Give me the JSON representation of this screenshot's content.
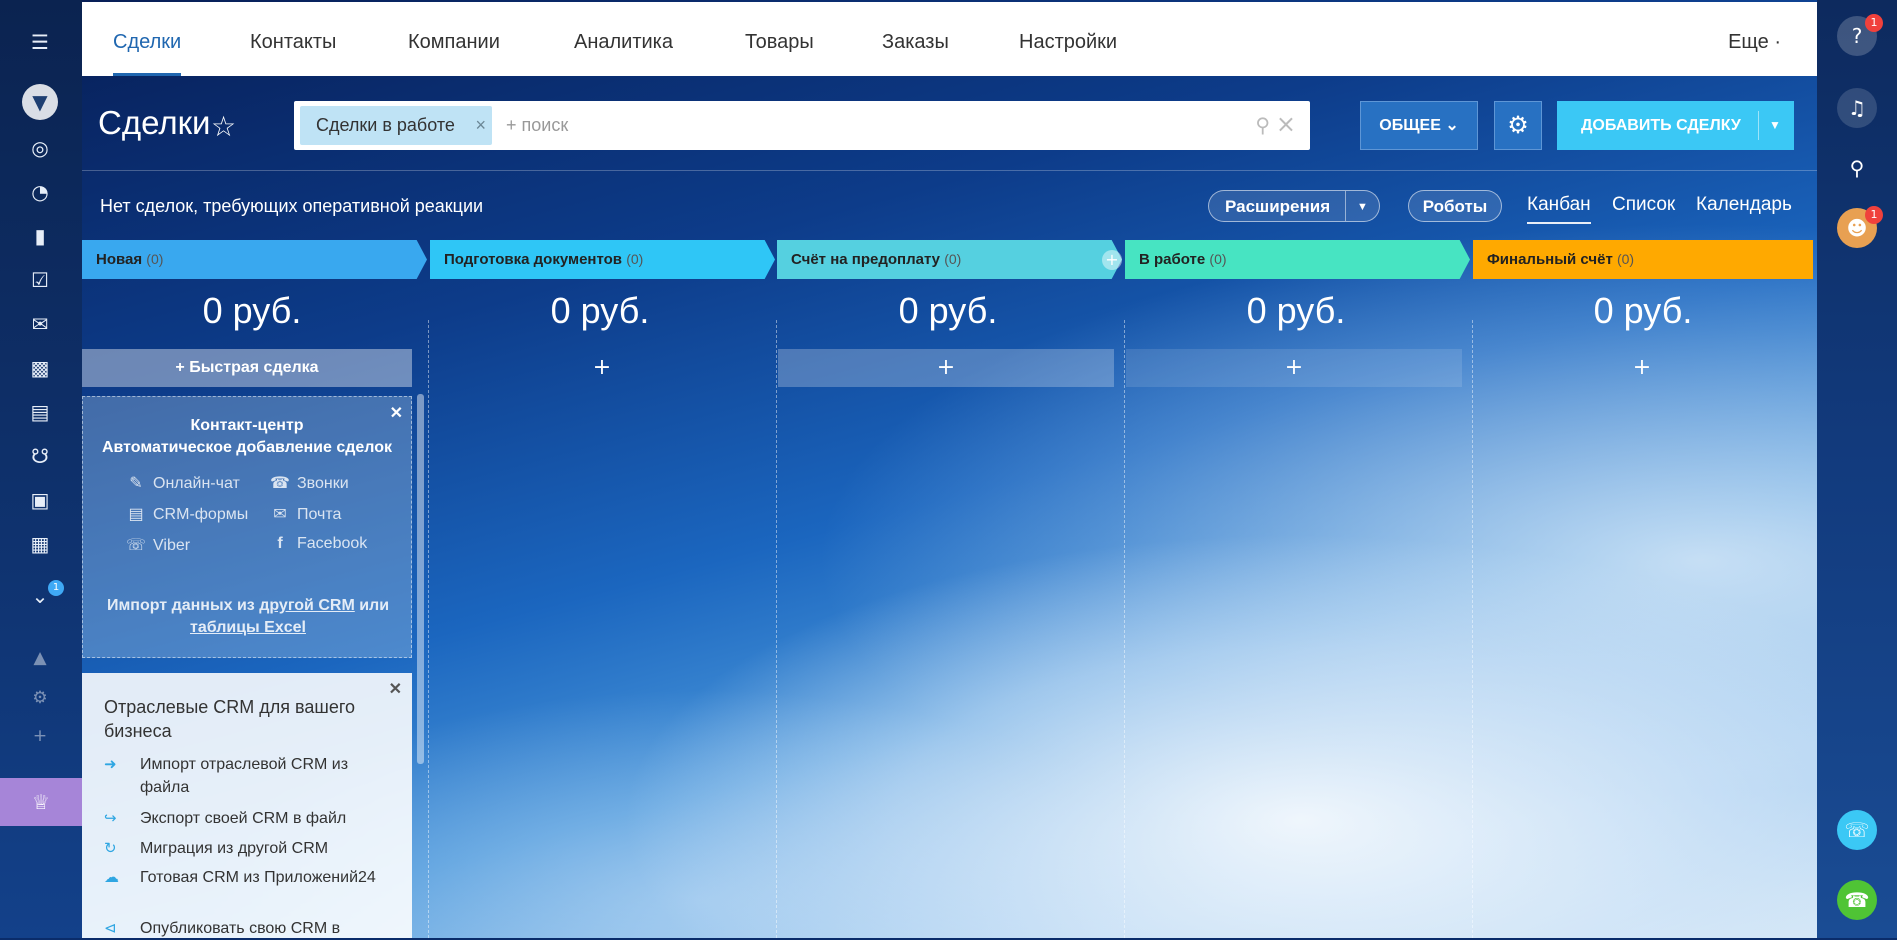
{
  "nav": {
    "tabs": [
      "Сделки",
      "Контакты",
      "Компании",
      "Аналитика",
      "Товары",
      "Заказы",
      "Настройки"
    ],
    "more": "Еще ·"
  },
  "sidebar": {
    "badge": "1"
  },
  "rightbar": {
    "help_badge": "1",
    "avatar_badge": "1"
  },
  "header": {
    "title": "Сделки",
    "filter_chip": "Сделки в работе",
    "chip_close": "×",
    "search_placeholder": "+ поиск",
    "general_button": "ОБЩЕЕ",
    "add_button": "ДОБАВИТЬ СДЕЛКУ"
  },
  "toolbar": {
    "notice": "Нет сделок, требующих оперативной реакции",
    "extensions": "Расширения",
    "robots": "Роботы",
    "views": [
      "Канбан",
      "Список",
      "Календарь"
    ]
  },
  "kanban": {
    "stages": [
      {
        "name": "Новая",
        "count": "(0)",
        "sum": "0 руб.",
        "color": "#39a8ef"
      },
      {
        "name": "Подготовка документов",
        "count": "(0)",
        "sum": "0 руб.",
        "color": "#2fc6f6"
      },
      {
        "name": "Счёт на предоплату",
        "count": "(0)",
        "sum": "0 руб.",
        "color": "#55d0e0"
      },
      {
        "name": "В работе",
        "count": "(0)",
        "sum": "0 руб.",
        "color": "#47e4c2"
      },
      {
        "name": "Финальный счёт",
        "count": "(0)",
        "sum": "0 руб.",
        "color": "#ffa900"
      }
    ],
    "quick_deal": "+ Быстрая сделка",
    "add_symbol": "+"
  },
  "contact_center": {
    "title1": "Контакт-центр",
    "title2": "Автоматическое добавление сделок",
    "channels": [
      "Онлайн-чат",
      "Звонки",
      "CRM-формы",
      "Почта",
      "Viber",
      "Facebook"
    ],
    "import_pre": "Импорт данных из ",
    "import_link1": "другой CRM",
    "import_mid": " или",
    "import_link2": "таблицы Excel"
  },
  "industry": {
    "title": "Отраслевые CRM для вашего бизнеса",
    "items": [
      "Импорт отраслевой CRM из файла",
      "Экспорт своей CRM в файл",
      "Миграция из другой CRM",
      "Готовая CRM из Приложений24",
      "Опубликовать свою CRM в"
    ]
  }
}
